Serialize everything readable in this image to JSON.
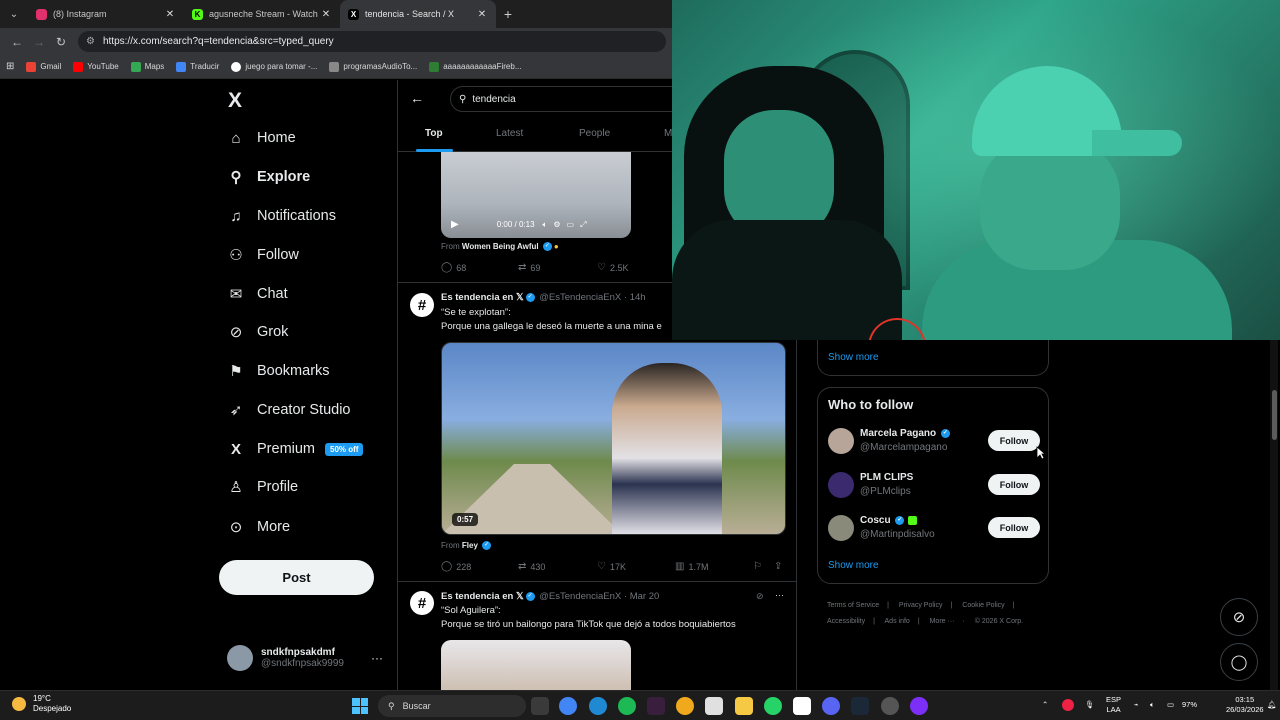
{
  "browser": {
    "tabs": [
      {
        "title": "(8) Instagram",
        "color": "#e1306c",
        "glyph": ""
      },
      {
        "title": "agusneche Stream - Watch Live",
        "color": "#53fc18",
        "glyph": "K"
      },
      {
        "title": "tendencia - Search / X",
        "color": "#000000",
        "glyph": "X",
        "active": true
      }
    ],
    "url": "https://x.com/search?q=tendencia&src=typed_query",
    "bookmarks": [
      {
        "label": "Gmail",
        "color": "#ea4335"
      },
      {
        "label": "YouTube",
        "color": "#ff0000"
      },
      {
        "label": "Maps",
        "color": "#34a853"
      },
      {
        "label": "Traducir",
        "color": "#4285f4"
      },
      {
        "label": "juego para tomar -...",
        "color": "#ffffff"
      },
      {
        "label": "programasAudioTo...",
        "color": "#888888"
      },
      {
        "label": "aaaaaaaaaaaaFireb...",
        "color": "#2e7d32"
      }
    ]
  },
  "nav": {
    "logo": "X",
    "items": [
      {
        "label": "Home",
        "icon": "home-icon",
        "glyph": "⌂"
      },
      {
        "label": "Explore",
        "icon": "search-icon",
        "glyph": "⚲",
        "bold": true
      },
      {
        "label": "Notifications",
        "icon": "bell-icon",
        "glyph": "🔔︎"
      },
      {
        "label": "Follow",
        "icon": "add-person-icon",
        "glyph": "👤︎"
      },
      {
        "label": "Chat",
        "icon": "mail-icon",
        "glyph": "✉"
      },
      {
        "label": "Grok",
        "icon": "grok-icon",
        "glyph": "⊘"
      },
      {
        "label": "Bookmarks",
        "icon": "bookmark-icon",
        "glyph": "⚑"
      },
      {
        "label": "Creator Studio",
        "icon": "rocket-icon",
        "glyph": "➶"
      },
      {
        "label": "Premium",
        "icon": "x-premium-icon",
        "glyph": "X",
        "badge": "50% off"
      },
      {
        "label": "Profile",
        "icon": "person-icon",
        "glyph": "♙"
      },
      {
        "label": "More",
        "icon": "more-circle-icon",
        "glyph": "⋯"
      }
    ],
    "post_label": "Post",
    "account": {
      "name": "sndkfnpsakdmf",
      "handle": "@sndkfnpsak9999"
    }
  },
  "search": {
    "query": "tendencia",
    "tabs": [
      "Top",
      "Latest",
      "People",
      "M"
    ]
  },
  "feed": {
    "video1": {
      "time": "0:00 / 0:13",
      "from_label": "From",
      "from_name": "Women Being Awful",
      "replies": "68",
      "reposts": "69",
      "likes": "2.5K"
    },
    "tweet2": {
      "name": "Es tendencia en 𝕏",
      "handle": "@EsTendenciaEnX",
      "time": "14h",
      "line1": "“Se te explotan”:",
      "line2": "Porque una gallega le deseó la muerte a una mina e",
      "duration": "0:57",
      "from_label": "From",
      "from_name": "Fley",
      "replies": "228",
      "reposts": "430",
      "likes": "17K",
      "views": "1.7M"
    },
    "tweet3": {
      "name": "Es tendencia en 𝕏",
      "handle": "@EsTendenciaEnX",
      "time": "Mar 20",
      "line1": "“Sol Aguilera”:",
      "line2": "Porque se tiró un bailongo para TikTok que dejó a todos boquiabiertos"
    }
  },
  "sidebar": {
    "show_more_top": "Show more",
    "who_to_follow": {
      "title": "Who to follow",
      "accounts": [
        {
          "name": "Marcela Pagano",
          "handle": "@Marcelampagano",
          "button": "Follow",
          "color": "#b7a59a"
        },
        {
          "name": "PLM CLIPS",
          "handle": "@PLMclips",
          "button": "Follow",
          "color": "#3b2a6e"
        },
        {
          "name": "Coscu",
          "handle": "@Martinpdisalvo",
          "button": "Follow",
          "color": "#8a8a7a"
        }
      ],
      "show_more": "Show more"
    },
    "footer": [
      "Terms of Service",
      "Privacy Policy",
      "Cookie Policy",
      "Accessibility",
      "Ads info",
      "More ···",
      "© 2026 X Corp."
    ]
  },
  "taskbar": {
    "temp": "19°C",
    "weather": "Despejado",
    "search_placeholder": "Buscar",
    "lang": "ESP",
    "lang2": "LAA",
    "battery": "97%",
    "time": "03:15",
    "date": "26/03/2026"
  }
}
